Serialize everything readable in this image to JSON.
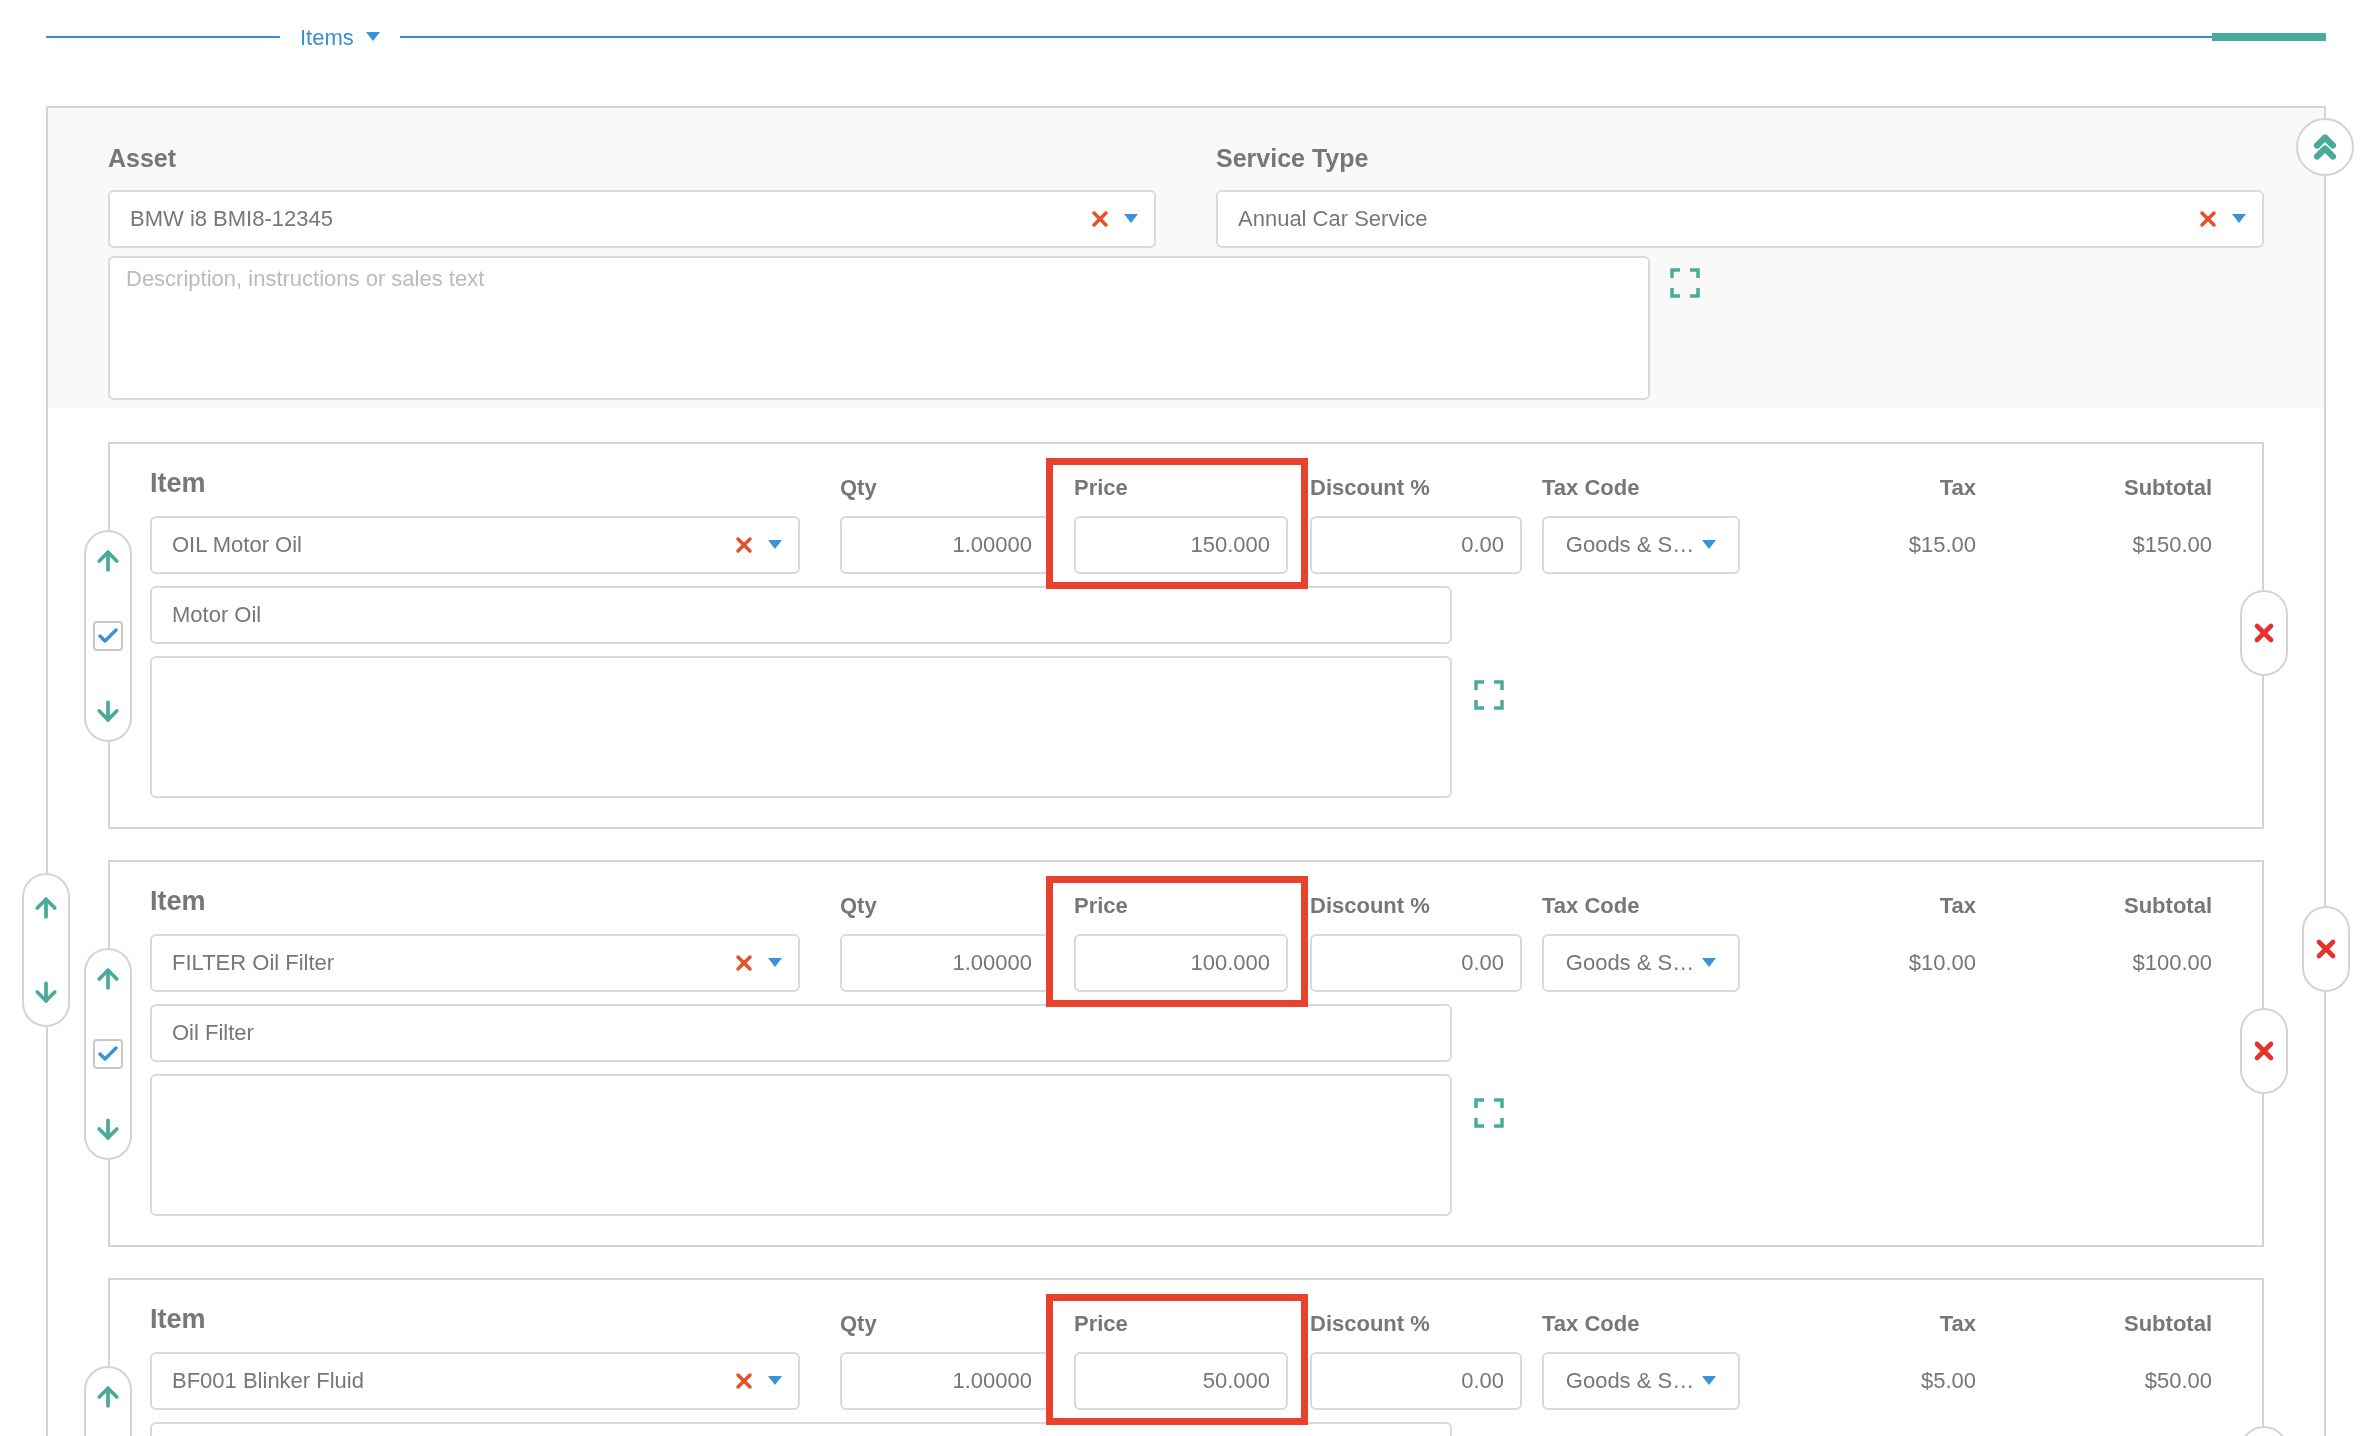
{
  "section": {
    "title": "Items"
  },
  "asset": {
    "label": "Asset",
    "value": "BMW i8 BMI8-12345"
  },
  "service_type": {
    "label": "Service Type",
    "value": "Annual Car Service"
  },
  "description": {
    "placeholder": "Description, instructions or sales text"
  },
  "items": [
    {
      "headers": {
        "item": "Item",
        "qty": "Qty",
        "price": "Price",
        "discount": "Discount %",
        "tax_code": "Tax Code",
        "tax": "Tax",
        "subtotal": "Subtotal"
      },
      "item": "OIL Motor Oil",
      "qty": "1.00000",
      "price": "150.000",
      "price_highlighted": true,
      "discount": "0.00",
      "tax_code": "Goods & S…",
      "tax": "$15.00",
      "subtotal": "$150.00",
      "name": "Motor Oil",
      "checked": true
    },
    {
      "headers": {
        "item": "Item",
        "qty": "Qty",
        "price": "Price",
        "discount": "Discount %",
        "tax_code": "Tax Code",
        "tax": "Tax",
        "subtotal": "Subtotal"
      },
      "item": "FILTER Oil Filter",
      "qty": "1.00000",
      "price": "100.000",
      "price_highlighted": true,
      "discount": "0.00",
      "tax_code": "Goods & S…",
      "tax": "$10.00",
      "subtotal": "$100.00",
      "name": "Oil Filter",
      "checked": true
    },
    {
      "headers": {
        "item": "Item",
        "qty": "Qty",
        "price": "Price",
        "discount": "Discount %",
        "tax_code": "Tax Code",
        "tax": "Tax",
        "subtotal": "Subtotal"
      },
      "item": "BF001 Blinker Fluid",
      "qty": "1.00000",
      "price": "50.000",
      "price_highlighted": true,
      "discount": "0.00",
      "tax_code": "Goods & S…",
      "tax": "$5.00",
      "subtotal": "$50.00"
    }
  ]
}
